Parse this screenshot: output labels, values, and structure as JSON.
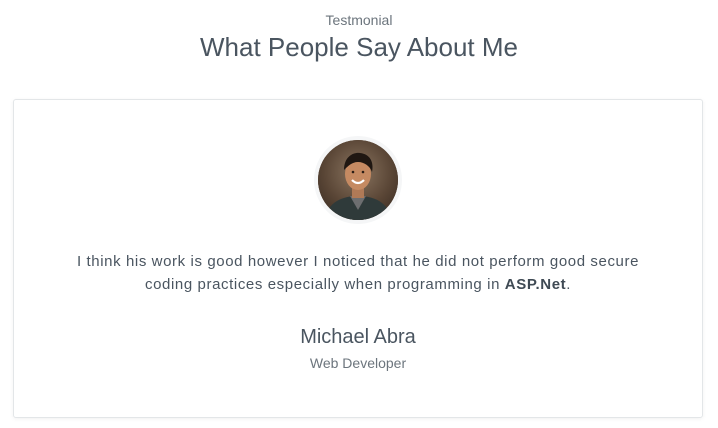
{
  "section": {
    "eyebrow": "Testmonial",
    "heading": "What People Say About Me"
  },
  "testimonial": {
    "quote_before": "I think his work is good however I noticed that he did not perform good secure coding practices especially when programming in ",
    "quote_emphasis": "ASP.Net",
    "quote_after": ".",
    "author_name": "Michael Abra",
    "author_role": "Web Developer",
    "avatar_icon": "person-photo"
  }
}
